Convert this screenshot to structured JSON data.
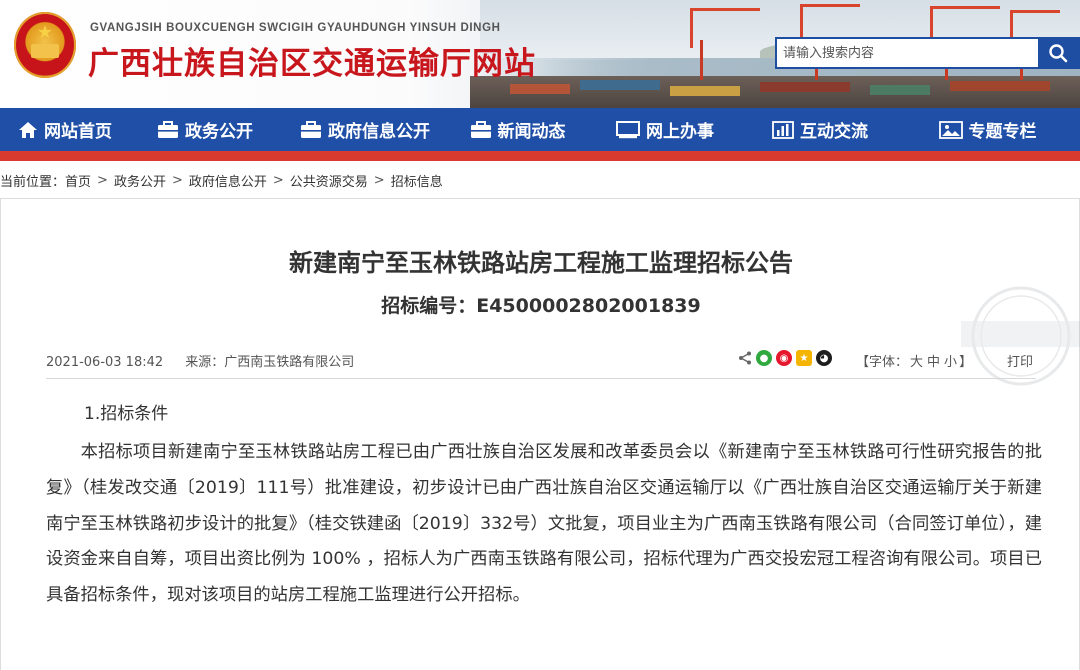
{
  "header": {
    "pinyin": "GVANGJSIH BOUXCUENGH SWCIGIH GYAUHDUNGH YINSUH DINGH",
    "title": "广西壮族自治区交通运输厅网站",
    "search_placeholder": "请输入搜索内容"
  },
  "nav": {
    "items": [
      {
        "label": "网站首页",
        "icon": "home-icon"
      },
      {
        "label": "政务公开",
        "icon": "briefcase-icon"
      },
      {
        "label": "政府信息公开",
        "icon": "briefcase-icon"
      },
      {
        "label": "新闻动态",
        "icon": "briefcase-icon"
      },
      {
        "label": "网上办事",
        "icon": "monitor-icon"
      },
      {
        "label": "互动交流",
        "icon": "bar-chart-icon"
      },
      {
        "label": "专题专栏",
        "icon": "image-icon"
      }
    ]
  },
  "breadcrumb": {
    "prefix": "当前位置：",
    "items": [
      "首页",
      "政务公开",
      "政府信息公开",
      "公共资源交易",
      "招标信息"
    ],
    "separator": ">"
  },
  "article": {
    "title": "新建南宁至玉林铁路站房工程施工监理招标公告",
    "code": "招标编号：E4500002802001839",
    "date": "2021-06-03 18:42",
    "source": "来源：广西南玉铁路有限公司",
    "font_label": "【字体：",
    "font_options": [
      "大",
      "中",
      "小"
    ],
    "font_close": "】",
    "print_label": "打印",
    "section_heading": "1.招标条件",
    "paragraph": "本招标项目新建南宁至玉林铁路站房工程已由广西壮族自治区发展和改革委员会以《新建南宁至玉林铁路可行性研究报告的批复》（桂发改交通〔2019〕111号）批准建设，初步设计已由广西壮族自治区交通运输厅以《广西壮族自治区交通运输厅关于新建南宁至玉林铁路初步设计的批复》（桂交铁建函〔2019〕332号）文批复，项目业主为广西南玉铁路有限公司（合同签订单位），建设资金来自自筹，项目出资比例为 100% ，招标人为广西南玉铁路有限公司，招标代理为广西交投宏冠工程咨询有限公司。项目已具备招标条件，现对该项目的站房工程施工监理进行公开招标。"
  },
  "colors": {
    "brand_red": "#c8161d",
    "nav_blue": "#1f4fa6",
    "nav_accent_red": "#d83a30"
  }
}
